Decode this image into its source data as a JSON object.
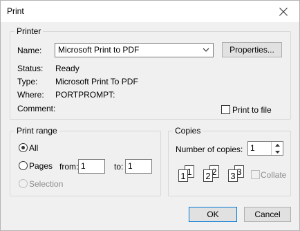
{
  "window": {
    "title": "Print"
  },
  "printer": {
    "group_label": "Printer",
    "name_label": "Name:",
    "name_value": "Microsoft Print to PDF",
    "properties_label": "Properties...",
    "status_label": "Status:",
    "status_value": "Ready",
    "type_label": "Type:",
    "type_value": "Microsoft Print To PDF",
    "where_label": "Where:",
    "where_value": "PORTPROMPT:",
    "comment_label": "Comment:",
    "comment_value": "",
    "print_to_file_label": "Print to file",
    "print_to_file_checked": false
  },
  "print_range": {
    "group_label": "Print range",
    "all_label": "All",
    "pages_label": "Pages",
    "from_label": "from:",
    "from_value": "1",
    "to_label": "to:",
    "to_value": "1",
    "selection_label": "Selection",
    "selected": "All"
  },
  "copies": {
    "group_label": "Copies",
    "number_label": "Number of copies:",
    "number_value": "1",
    "collate_label": "Collate",
    "collate_checked": false,
    "page_icons": [
      "1",
      "1",
      "2",
      "2",
      "3",
      "3"
    ]
  },
  "buttons": {
    "ok": "OK",
    "cancel": "Cancel"
  },
  "icons": {
    "close": "close-icon",
    "dropdown": "chevron-down-icon",
    "spin_up": "spin-up-icon",
    "spin_down": "spin-down-icon",
    "collate": "collate-pages-icon"
  },
  "colors": {
    "dialog_bg": "#f0f0f0",
    "titlebar_bg": "#ffffff",
    "button_bg": "#e1e1e1",
    "disabled_text": "#8d8d8d"
  }
}
